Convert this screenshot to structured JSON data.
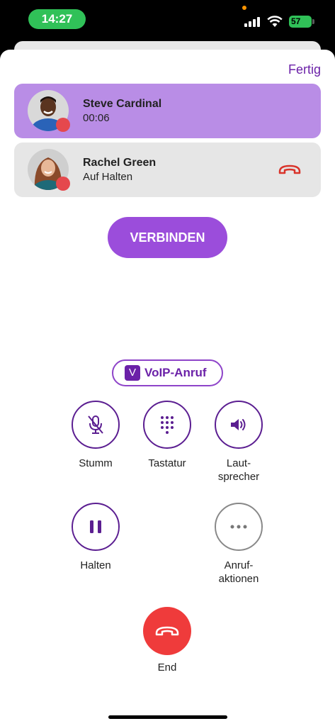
{
  "status_bar": {
    "time": "14:27",
    "battery": "57"
  },
  "header": {
    "done_label": "Fertig"
  },
  "calls": [
    {
      "name": "Steve Cardinal",
      "status": "00:06",
      "state": "active"
    },
    {
      "name": "Rachel Green",
      "status": "Auf Halten",
      "state": "held"
    }
  ],
  "connect_label": "VERBINDEN",
  "voip": {
    "badge_letter": "V",
    "label": "VoIP-Anruf"
  },
  "controls": {
    "mute": {
      "label": "Stumm",
      "icon": "microphone-off-icon"
    },
    "keypad": {
      "label": "Tastatur",
      "icon": "keypad-icon"
    },
    "speaker_line1": "Laut-",
    "speaker_line2": "sprecher",
    "speaker_icon": "speaker-icon",
    "hold": {
      "label": "Halten",
      "icon": "pause-icon"
    },
    "actions_line1": "Anruf-",
    "actions_line2": "aktionen",
    "actions_icon": "more-icon",
    "end": {
      "label": "End",
      "icon": "hangup-icon"
    }
  },
  "colors": {
    "accent": "#9b4ddb",
    "active_card": "#b98de6",
    "end_red": "#ef3b3b",
    "status_green": "#30c158"
  }
}
